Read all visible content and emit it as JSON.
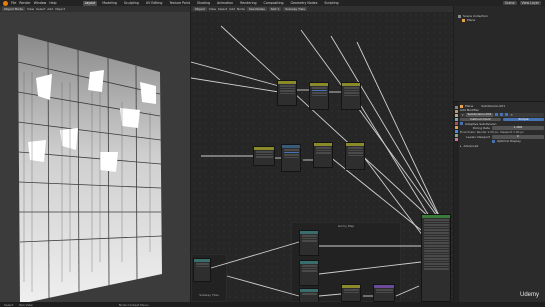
{
  "menubar": {
    "items": [
      "File",
      "Render",
      "Window",
      "Help"
    ],
    "workspaces": [
      "Layout",
      "Modeling",
      "Sculpting",
      "UV Editing",
      "Texture Paint",
      "Shading",
      "Animation",
      "Rendering",
      "Compositing",
      "Geometry Nodes",
      "Scripting"
    ],
    "scene_label": "Scene",
    "layer_label": "View Layer"
  },
  "viewport_header": {
    "mode": "Object Mode",
    "items": [
      "View",
      "Select",
      "Add",
      "Object"
    ]
  },
  "node_header": {
    "mode": "Object",
    "items": [
      "View",
      "Select",
      "Add",
      "Node"
    ],
    "use_nodes": "Use Nodes",
    "slot": "Slot 1",
    "material": "Subway Tiles"
  },
  "node_editor": {
    "frame_title_1": "Grimy Map",
    "frame_title_2": "Subway Tiles"
  },
  "outliner": {
    "collection": "Scene Collection",
    "item": "Plane"
  },
  "properties": {
    "object_name": "Plane",
    "modifier_name": "Subdivision.001",
    "add_modifier": "Add Modifier",
    "modifier": "Subdivision.001",
    "catmull": "Catmull-Clark",
    "simple": "Simple",
    "adaptive": "Adaptive Subdivision",
    "dicing_rate_label": "Dicing Rate",
    "dicing_rate": "1.000",
    "final_scale": "Final Scale: Render 1.00 px, Viewport 1.00 px",
    "levels_viewport_label": "Levels Viewport",
    "levels_viewport": "0",
    "optimal_display": "Optimal Display",
    "advanced": "Advanced"
  },
  "statusbar": {
    "items": [
      "Select",
      "Pan View",
      "Node Context Menu"
    ]
  },
  "watermark": "Udemy",
  "colors": {
    "accent": "#4772b3",
    "blender_orange": "#e87d0d",
    "node_yellow": "#8a8a2a",
    "node_blue": "#3a5a7a",
    "node_teal": "#3a6e6e",
    "node_green": "#3a7a3a",
    "node_purple": "#6a4a9a"
  }
}
